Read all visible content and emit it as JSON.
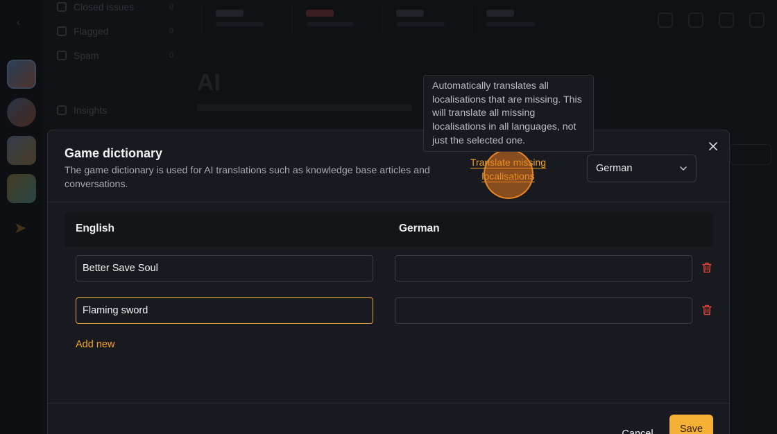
{
  "background": {
    "nav_items": [
      {
        "label": "Closed issues",
        "count": "0"
      },
      {
        "label": "Flagged",
        "count": "0"
      },
      {
        "label": "Spam",
        "count": "0"
      }
    ],
    "nav_section": "",
    "insights_label": "Insights",
    "page_title": "AI"
  },
  "modal": {
    "title": "Game dictionary",
    "description": "The game dictionary is used for AI translations such as knowledge base articles and conversations.",
    "translate_link_line1": "Translate missing",
    "translate_link_line2": "localisations",
    "language_select": "German",
    "columns": {
      "source": "English",
      "target": "German"
    },
    "rows": [
      {
        "english": "Better Save Soul",
        "german": ""
      },
      {
        "english": "Flaming sword",
        "german": ""
      }
    ],
    "add_new": "Add new",
    "cancel": "Cancel",
    "save": "Save"
  },
  "tooltip": {
    "text": "Automatically translates all localisations that are missing. This will translate all missing localisations in all languages, not just the selected one."
  },
  "colors": {
    "accent": "#f5a623",
    "save_bg": "#f5b036",
    "danger": "#d9443a",
    "focus_border": "#e8a545"
  },
  "icons": {
    "close": "close-icon",
    "dropdown": "chevron-down-icon",
    "delete": "trash-icon"
  }
}
